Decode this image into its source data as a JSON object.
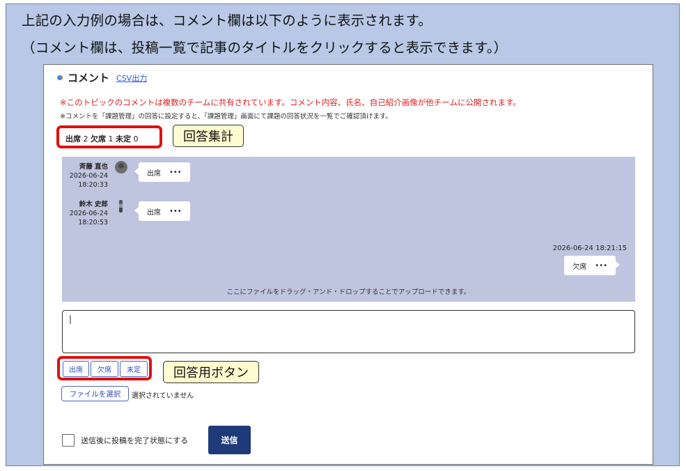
{
  "intro": {
    "line1": "上記の入力例の場合は、コメント欄は以下のように表示されます。",
    "line2": "（コメント欄は、投稿一覧で記事のタイトルをクリックすると表示できます。）"
  },
  "comment": {
    "title": "コメント",
    "csv_link": "CSV出力",
    "warning": "※このトピックのコメントは複数のチームに共有されています。コメント内容、氏名、自己紹介画像が他チームに公開されます。",
    "note": "※コメントを「課題管理」の回答に設定すると、「課題管理」画面にて課題の回答状況を一覧でご確認頂けます。",
    "tally": {
      "attend_label": "出席",
      "attend_count": "2",
      "absent_label": "欠席",
      "absent_count": "1",
      "undecided_label": "未定",
      "undecided_count": "0"
    }
  },
  "callouts": {
    "tally": "回答集計",
    "buttons": "回答用ボタン"
  },
  "thread": {
    "comments": [
      {
        "name": "斉藤 直也",
        "date": "2026-06-24",
        "time": "18:20:33",
        "text": "出席",
        "more": "•••"
      },
      {
        "name": "鈴木 史郎",
        "date": "2026-06-24",
        "time": "18:20:53",
        "text": "出席",
        "more": "•••"
      }
    ],
    "own": {
      "timestamp": "2026-06-24 18:21:15",
      "text": "欠席",
      "more": "•••"
    },
    "drop_hint": "ここにファイルをドラッグ・アンド・ドロップすることでアップロードできます。"
  },
  "input": {
    "value": "|"
  },
  "answer_buttons": [
    "出席",
    "欠席",
    "未定"
  ],
  "file": {
    "button": "ファイルを選択",
    "status": "選択されていません"
  },
  "complete_label": "送信後に投稿を完了状態にする",
  "send_label": "送信",
  "colors": {
    "accent": "#1f3a78",
    "highlight": "#e01010",
    "thread_bg": "#bfc5de",
    "frame_bg": "#b9c8e6"
  }
}
